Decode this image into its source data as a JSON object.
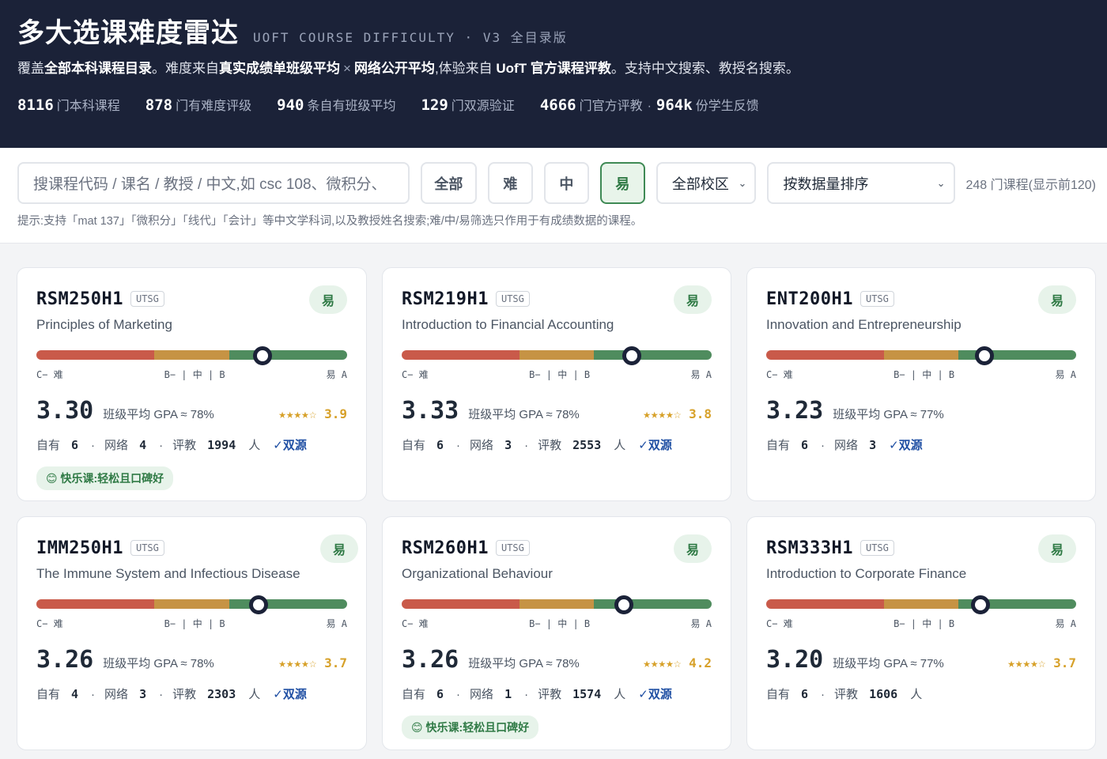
{
  "header": {
    "title": "多大选课难度雷达",
    "subtitle": "UOFT COURSE DIFFICULTY · V3 全目录版",
    "desc": {
      "p1": "覆盖",
      "b1": "全部本科课程目录",
      "p2": "。难度来自",
      "b2": "真实成绩单班级平均",
      "x": "×",
      "b3": "网络公开平均",
      "p3": ",体验来自 ",
      "b4": "UofT 官方课程评教",
      "p4": "。支持中文搜索、教授名搜索。"
    },
    "stats": [
      {
        "num": "8116",
        "label": "门本科课程"
      },
      {
        "num": "878",
        "label": "门有难度评级"
      },
      {
        "num": "940",
        "label": "条自有班级平均"
      },
      {
        "num": "129",
        "label": "门双源验证"
      }
    ],
    "stat_last": {
      "num": "4666",
      "label": "门官方评教",
      "sep": "·",
      "num2": "964k",
      "label2": "份学生反馈"
    }
  },
  "toolbar": {
    "search_placeholder": "搜课程代码 / 课名 / 教授 / 中文,如 csc 108、微积分、",
    "filters": {
      "all": "全部",
      "hard": "难",
      "mid": "中",
      "easy": "易"
    },
    "campus": "全部校区",
    "sort": "按数据量排序",
    "count": "248 门课程(显示前120)",
    "hint": "提示:支持「mat 137」「微积分」「线代」「会计」等中文学科词,以及教授姓名搜索;难/中/易筛选只作用于有成绩数据的课程。"
  },
  "labels": {
    "scale_left": "C− 难",
    "scale_mid": "B− | 中 | B",
    "scale_right": "易 A",
    "gpa_note_prefix": "班级平均 GPA ≈ ",
    "own": "自有",
    "web": "网络",
    "eval": "评教",
    "dot": "·",
    "people": "人",
    "dual": "✓双源"
  },
  "courses": [
    {
      "code": "RSM250H1",
      "campus": "UTSG",
      "difficulty": "易",
      "name": "Principles of Marketing",
      "difficulty_position": 0.729,
      "gpa": "3.30",
      "avg": "78%",
      "stars": "★★★★☆",
      "rating": "3.9",
      "own": "6",
      "web": "4",
      "eval": "1994",
      "dual": true,
      "happy": "😊 快乐课:轻松且口碑好"
    },
    {
      "code": "RSM219H1",
      "campus": "UTSG",
      "difficulty": "易",
      "name": "Introduction to Financial Accounting",
      "difficulty_position": 0.743,
      "gpa": "3.33",
      "avg": "78%",
      "stars": "★★★★☆",
      "rating": "3.8",
      "own": "6",
      "web": "3",
      "eval": "2553",
      "dual": true,
      "happy": ""
    },
    {
      "code": "ENT200H1",
      "campus": "UTSG",
      "difficulty": "易",
      "name": "Innovation and Entrepreneurship",
      "difficulty_position": 0.703,
      "gpa": "3.23",
      "avg": "77%",
      "stars": "",
      "rating": "",
      "own": "6",
      "web": "3",
      "eval": "",
      "dual": true,
      "happy": ""
    },
    {
      "code": "IMM250H1",
      "campus": "UTSG",
      "difficulty": "易",
      "name": "The Immune System and Infectious Disease",
      "difficulty_position": 0.716,
      "gpa": "3.26",
      "avg": "78%",
      "stars": "★★★★☆",
      "rating": "3.7",
      "own": "4",
      "web": "3",
      "eval": "2303",
      "dual": true,
      "happy": ""
    },
    {
      "code": "RSM260H1",
      "campus": "UTSG",
      "difficulty": "易",
      "name": "Organizational Behaviour",
      "difficulty_position": 0.716,
      "gpa": "3.26",
      "avg": "78%",
      "stars": "★★★★☆",
      "rating": "4.2",
      "own": "6",
      "web": "1",
      "eval": "1574",
      "dual": true,
      "happy": "😊 快乐课:轻松且口碑好"
    },
    {
      "code": "RSM333H1",
      "campus": "UTSG",
      "difficulty": "易",
      "name": "Introduction to Corporate Finance",
      "difficulty_position": 0.692,
      "gpa": "3.20",
      "avg": "77%",
      "stars": "★★★★☆",
      "rating": "3.7",
      "own": "6",
      "web": "",
      "eval": "1606",
      "dual": false,
      "happy": ""
    }
  ]
}
